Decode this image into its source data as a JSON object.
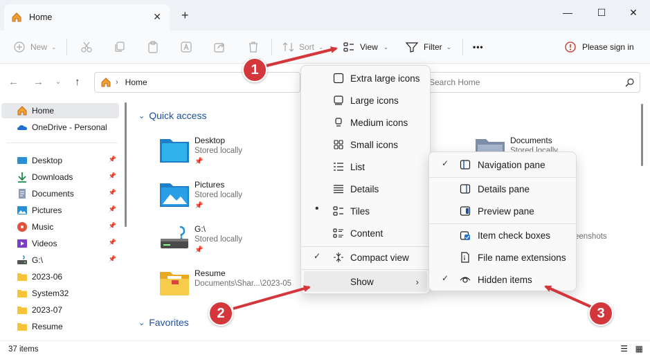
{
  "window": {
    "tab_title": "Home",
    "new_tab": "+",
    "minimize": "—",
    "maximize": "☐",
    "close": "✕",
    "tab_close": "✕"
  },
  "toolbar": {
    "new_label": "New",
    "sort_label": "Sort",
    "view_label": "View",
    "filter_label": "Filter",
    "more_label": "•••",
    "sign_in_label": "Please sign in"
  },
  "address": {
    "path": "Home",
    "search_placeholder": "Search Home"
  },
  "sidebar": {
    "items": [
      {
        "label": "Home",
        "icon": "home-icon",
        "pinned": false
      },
      {
        "label": "OneDrive - Personal",
        "icon": "onedrive-icon",
        "pinned": false
      },
      {
        "label": "Desktop",
        "icon": "desktop-icon",
        "pinned": true
      },
      {
        "label": "Downloads",
        "icon": "downloads-icon",
        "pinned": true
      },
      {
        "label": "Documents",
        "icon": "documents-icon",
        "pinned": true
      },
      {
        "label": "Pictures",
        "icon": "pictures-icon",
        "pinned": true
      },
      {
        "label": "Music",
        "icon": "music-icon",
        "pinned": true
      },
      {
        "label": "Videos",
        "icon": "videos-icon",
        "pinned": true
      },
      {
        "label": "G:\\",
        "icon": "drive-icon",
        "pinned": true
      },
      {
        "label": "2023-06",
        "icon": "folder-icon",
        "pinned": false
      },
      {
        "label": "System32",
        "icon": "folder-icon",
        "pinned": false
      },
      {
        "label": "2023-07",
        "icon": "folder-icon",
        "pinned": false
      },
      {
        "label": "Resume",
        "icon": "folder-icon",
        "pinned": false
      }
    ]
  },
  "main": {
    "quick_access_title": "Quick access",
    "favorites_title": "Favorites",
    "quick_access": [
      {
        "name": "Desktop",
        "sub": "Stored locally",
        "icon": "desktop-folder-icon"
      },
      {
        "name": "Pictures",
        "sub": "Stored locally",
        "icon": "pictures-folder-icon"
      },
      {
        "name": "G:\\",
        "sub": "Stored locally",
        "icon": "drive-icon"
      },
      {
        "name": "Resume",
        "sub": "Documents\\Shar...\\2023-05",
        "icon": "folder-icon"
      },
      {
        "name": "Documents",
        "sub": "Stored locally",
        "icon": "documents-folder-icon"
      },
      {
        "name": "",
        "sub": "eenshots",
        "icon": "screenshots-folder-icon"
      }
    ]
  },
  "view_menu": {
    "items": [
      {
        "label": "Extra large icons",
        "icon": "extra-large-icons-icon"
      },
      {
        "label": "Large icons",
        "icon": "large-icons-icon"
      },
      {
        "label": "Medium icons",
        "icon": "medium-icons-icon"
      },
      {
        "label": "Small icons",
        "icon": "small-icons-icon"
      },
      {
        "label": "List",
        "icon": "list-icon"
      },
      {
        "label": "Details",
        "icon": "details-icon"
      },
      {
        "label": "Tiles",
        "icon": "tiles-icon",
        "selected": true
      },
      {
        "label": "Content",
        "icon": "content-icon"
      },
      {
        "label": "Compact view",
        "icon": "compact-view-icon",
        "checked": true
      },
      {
        "label": "Show",
        "icon": "",
        "submenu": true,
        "highlighted": true
      }
    ]
  },
  "show_menu": {
    "items": [
      {
        "label": "Navigation pane",
        "icon": "navigation-pane-icon",
        "checked": true
      },
      {
        "label": "Details pane",
        "icon": "details-pane-icon"
      },
      {
        "label": "Preview pane",
        "icon": "preview-pane-icon"
      },
      {
        "label": "Item check boxes",
        "icon": "item-check-boxes-icon"
      },
      {
        "label": "File name extensions",
        "icon": "file-extensions-icon"
      },
      {
        "label": "Hidden items",
        "icon": "hidden-items-icon",
        "checked": true
      }
    ]
  },
  "annotations": {
    "badge_1": "1",
    "badge_2": "2",
    "badge_3": "3",
    "arrow_color": "#d4373b"
  },
  "status": {
    "item_count": "37 items"
  },
  "colors": {
    "accent": "#1f4fa1",
    "badge": "#d4373b",
    "folder": "#f5c23a"
  }
}
